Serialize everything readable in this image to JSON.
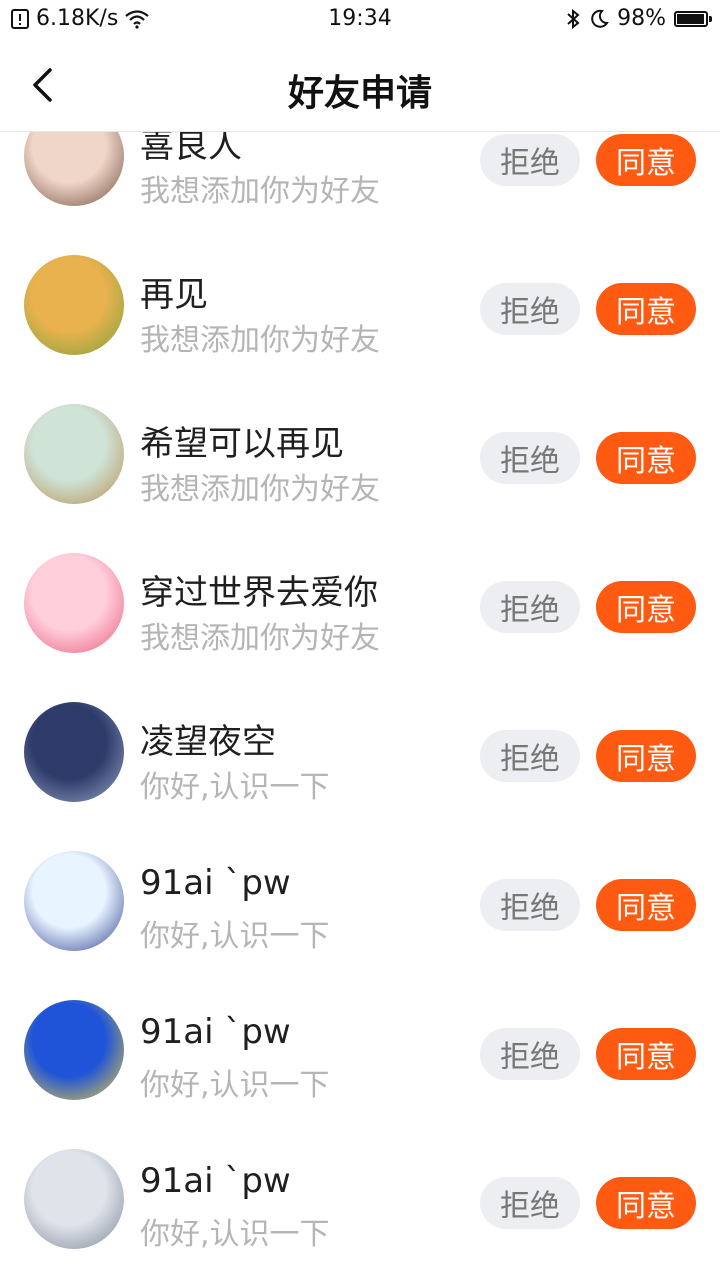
{
  "status_bar": {
    "net_speed": "6.18K/s",
    "time": "19:34",
    "battery": "98%",
    "battery_level": 0.98,
    "icons": [
      "alert-icon",
      "wifi-icon",
      "bluetooth-icon",
      "moon-icon",
      "battery-icon"
    ]
  },
  "header": {
    "title": "好友申请",
    "back_icon": "chevron-left-icon"
  },
  "buttons": {
    "reject_label": "拒绝",
    "accept_label": "同意"
  },
  "colors": {
    "accept": "#ff5a12",
    "reject_bg": "#eceef2",
    "muted_text": "#b5b5b5"
  },
  "requests": [
    {
      "name": "喜良人",
      "message": "我想添加你为好友",
      "avatar_colors": [
        "#f0d6c8",
        "#6b4a3a"
      ]
    },
    {
      "name": "再见",
      "message": "我想添加你为好友",
      "avatar_colors": [
        "#e9b24f",
        "#7aa13a"
      ]
    },
    {
      "name": "希望可以再见",
      "message": "我想添加你为好友",
      "avatar_colors": [
        "#cfe3d6",
        "#b58a4e"
      ]
    },
    {
      "name": "穿过世界去爱你",
      "message": "我想添加你为好友",
      "avatar_colors": [
        "#ffd0dc",
        "#e8587a"
      ]
    },
    {
      "name": "凌望夜空",
      "message": "你好,认识一下",
      "avatar_colors": [
        "#2d3a6a",
        "#9aa7c7"
      ]
    },
    {
      "name": "91ai `pw",
      "message": "你好,认识一下",
      "avatar_colors": [
        "#e8f4ff",
        "#2a3b8f"
      ]
    },
    {
      "name": "91ai `pw",
      "message": "你好,认识一下",
      "avatar_colors": [
        "#1f54d8",
        "#f0d23a"
      ]
    },
    {
      "name": "91ai `pw",
      "message": "你好,认识一下",
      "avatar_colors": [
        "#dfe3ea",
        "#7b8496"
      ]
    }
  ]
}
